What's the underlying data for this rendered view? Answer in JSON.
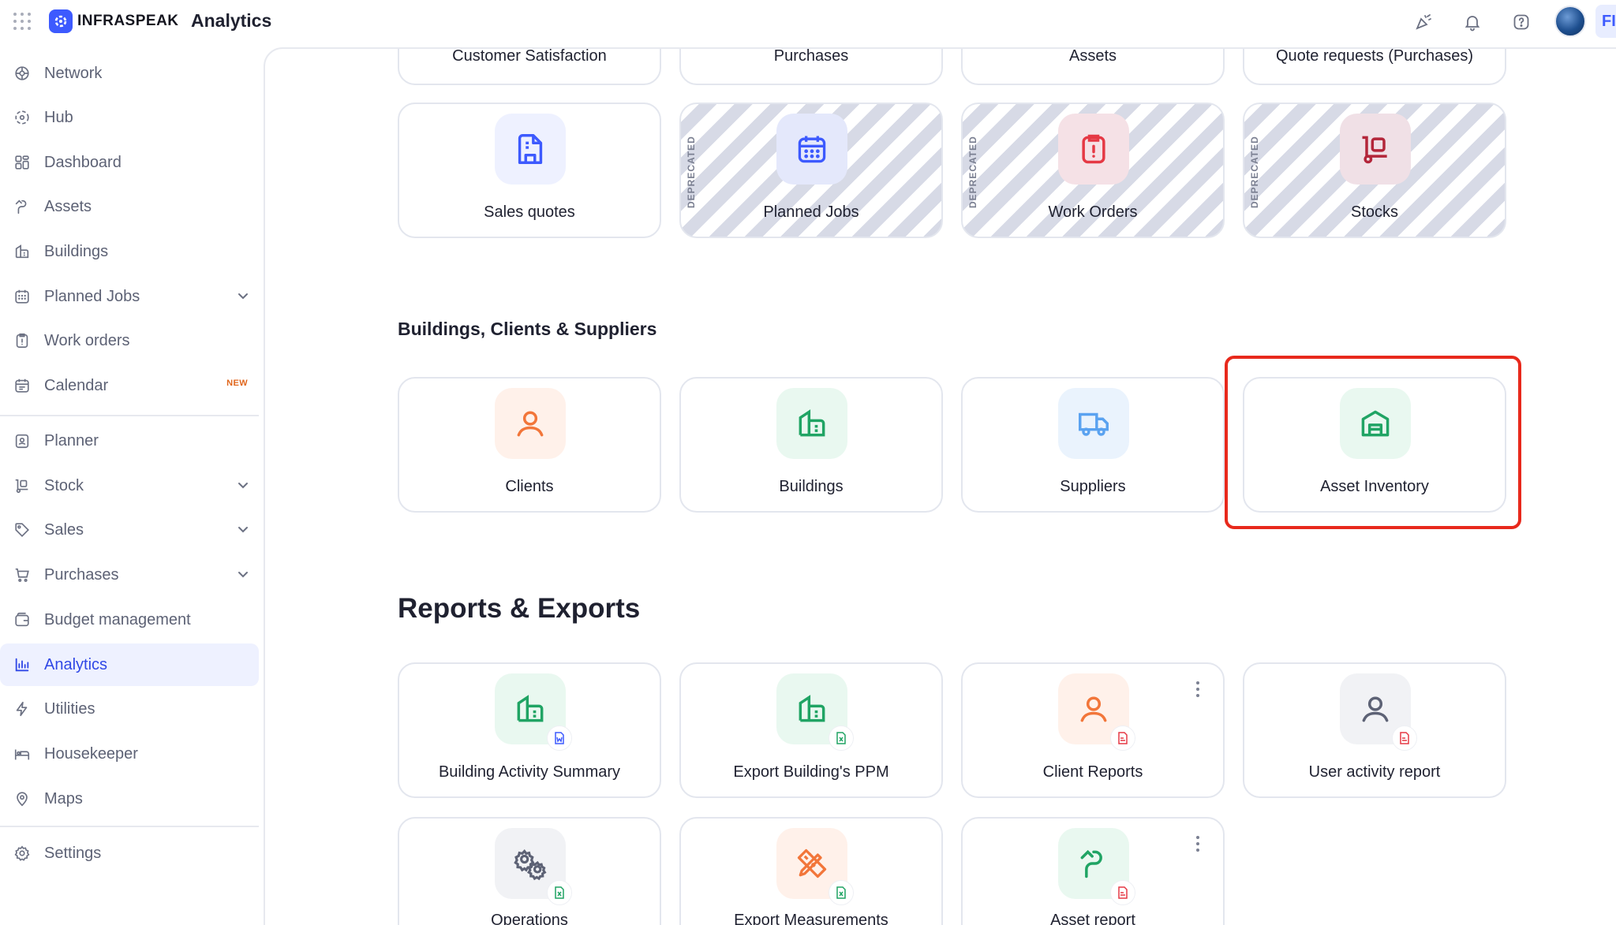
{
  "header": {
    "brand": "INFRASPEAK",
    "app_title": "Analytics",
    "user_initial": "FI"
  },
  "colors": {
    "accent": "#3d5afe",
    "active_bg": "#eef1ff",
    "highlight": "#e8291c"
  },
  "sidebar": {
    "items": [
      {
        "label": "Network",
        "icon": "network-icon"
      },
      {
        "label": "Hub",
        "icon": "hub-icon"
      },
      {
        "label": "Dashboard",
        "icon": "dashboard-icon"
      },
      {
        "label": "Assets",
        "icon": "assets-icon"
      },
      {
        "label": "Buildings",
        "icon": "buildings-icon"
      },
      {
        "label": "Planned Jobs",
        "icon": "calendar-grid-icon"
      },
      {
        "label": "Work orders",
        "icon": "clipboard-icon"
      },
      {
        "label": "Calendar",
        "icon": "calendar-icon",
        "badge": "NEW"
      },
      {
        "label": "Planner",
        "icon": "planner-icon"
      },
      {
        "label": "Stock",
        "icon": "stock-icon"
      },
      {
        "label": "Sales",
        "icon": "tag-icon"
      },
      {
        "label": "Purchases",
        "icon": "cart-icon"
      },
      {
        "label": "Budget management",
        "icon": "wallet-icon"
      },
      {
        "label": "Analytics",
        "icon": "chart-icon"
      },
      {
        "label": "Utilities",
        "icon": "bolt-icon"
      },
      {
        "label": "Housekeeper",
        "icon": "bed-icon"
      },
      {
        "label": "Maps",
        "icon": "pin-icon"
      },
      {
        "label": "Settings",
        "icon": "gear-icon"
      }
    ]
  },
  "top_row": [
    "Customer Satisfaction",
    "Purchases",
    "Assets",
    "Quote requests (Purchases)"
  ],
  "row2": [
    {
      "label": "Sales quotes",
      "deprecated": false
    },
    {
      "label": "Planned Jobs",
      "deprecated": true
    },
    {
      "label": "Work Orders",
      "deprecated": true
    },
    {
      "label": "Stocks",
      "deprecated": true
    }
  ],
  "deprecated_tag": "DEPRECATED",
  "section_bcs": {
    "title": "Buildings, Clients & Suppliers",
    "cards": [
      "Clients",
      "Buildings",
      "Suppliers",
      "Asset Inventory"
    ]
  },
  "section_reports": {
    "title": "Reports & Exports",
    "cards": [
      "Building Activity Summary",
      "Export Building's PPM",
      "Client Reports",
      "User activity report"
    ],
    "cards_row2": [
      "Operations",
      "Export Measurements",
      "Asset report"
    ]
  }
}
